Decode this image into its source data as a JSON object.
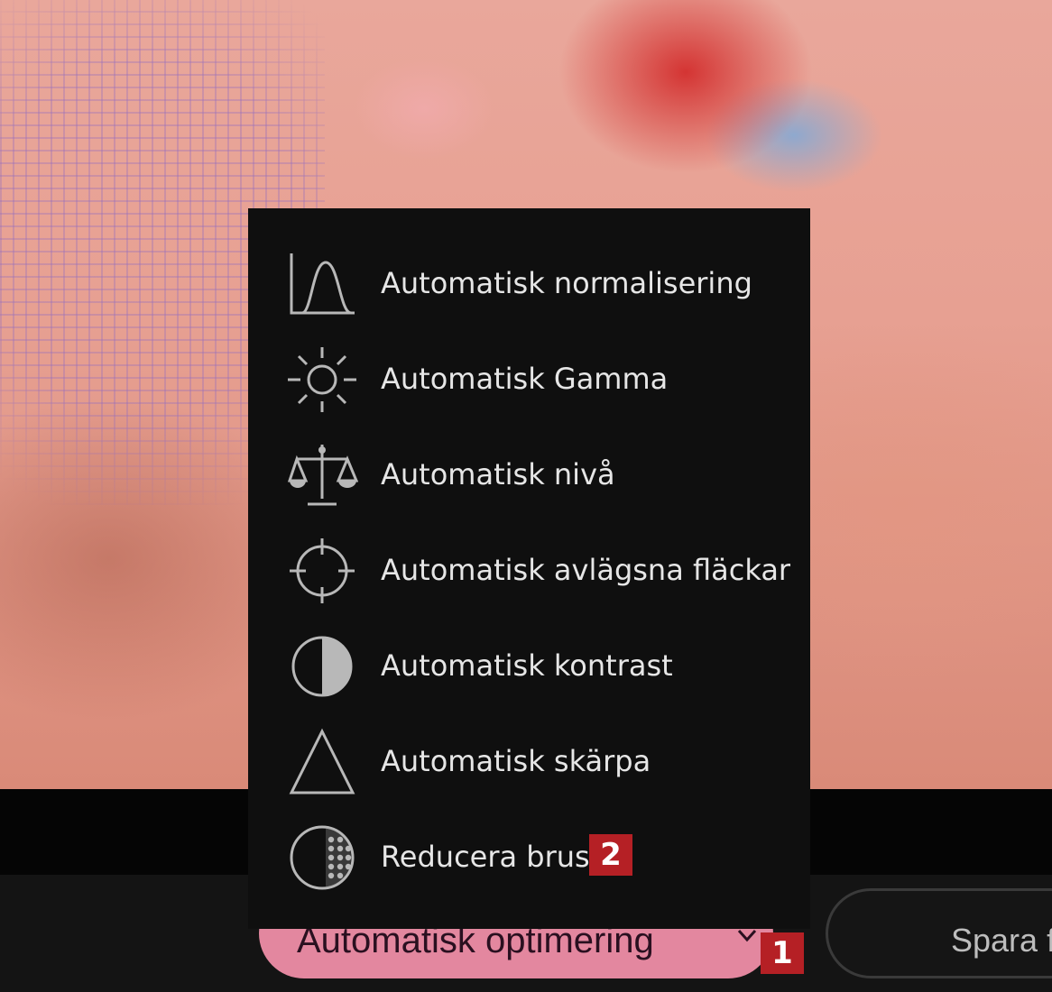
{
  "photo": {
    "description_icon": "photo-background"
  },
  "menu": {
    "items": [
      {
        "label": "Automatisk normalisering",
        "icon": "histogram-curve-icon"
      },
      {
        "label": "Automatisk Gamma",
        "icon": "sun-icon"
      },
      {
        "label": "Automatisk nivå",
        "icon": "scales-icon"
      },
      {
        "label": "Automatisk avlägsna fläckar",
        "icon": "crosshair-icon"
      },
      {
        "label": "Automatisk kontrast",
        "icon": "contrast-icon"
      },
      {
        "label": "Automatisk skärpa",
        "icon": "triangle-icon"
      },
      {
        "label": "Reducera brus",
        "icon": "noise-icon"
      }
    ]
  },
  "toolbar": {
    "optimize_label": "Automatisk optimering",
    "save_label": "Spara fi"
  },
  "badges": {
    "one": "1",
    "two": "2"
  },
  "colors": {
    "accent_pink": "#e3879f",
    "badge_red": "#b52025",
    "menu_bg": "#0f0f0f"
  }
}
